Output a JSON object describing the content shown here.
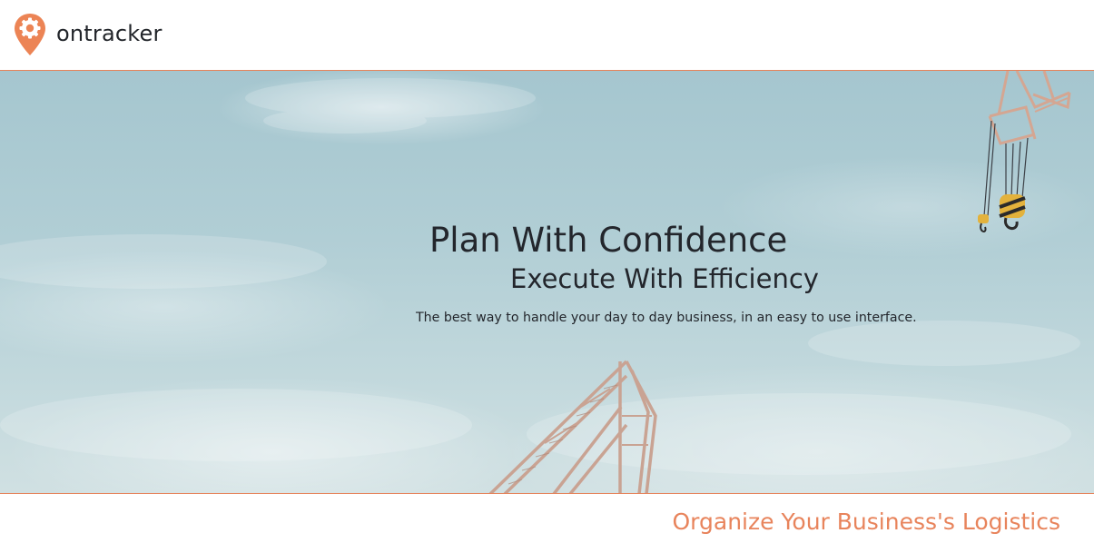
{
  "header": {
    "brand_name": "ontracker",
    "logo_icon": "map-pin-gear-icon"
  },
  "hero": {
    "headline": "Plan With Confidence",
    "subheadline": "Execute With Efficiency",
    "tagline": "The best way to handle your day to day business, in an easy to use interface.",
    "background": "sky-with-cranes-image"
  },
  "section": {
    "title": "Organize Your Business's Logistics"
  },
  "colors": {
    "accent": "#e8845c",
    "text": "#23262c",
    "sky": "#a5c6cf"
  }
}
